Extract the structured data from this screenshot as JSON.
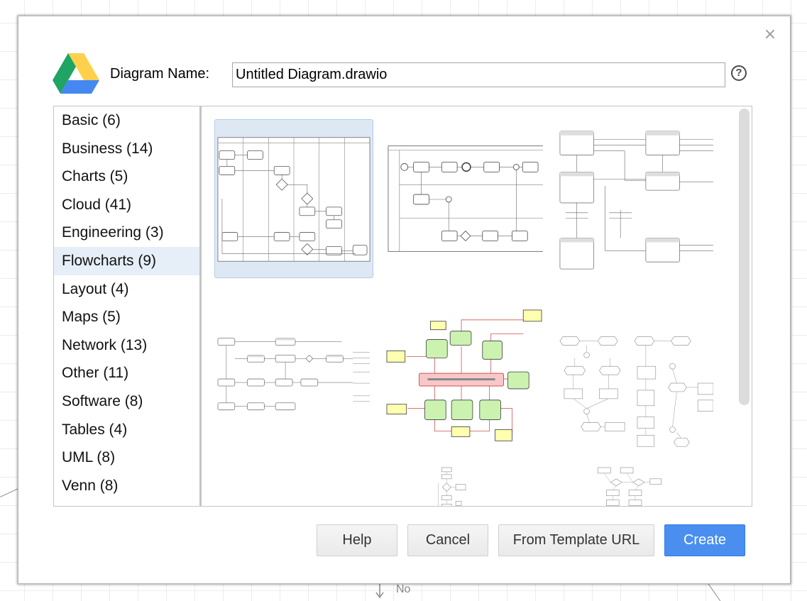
{
  "dialog": {
    "name_label": "Diagram Name:",
    "name_value": "Untitled Diagram.drawio",
    "help_glyph": "?",
    "close_glyph": "×"
  },
  "categories": [
    {
      "label": "Basic (6)",
      "selected": false
    },
    {
      "label": "Business (14)",
      "selected": false
    },
    {
      "label": "Charts (5)",
      "selected": false
    },
    {
      "label": "Cloud (41)",
      "selected": false
    },
    {
      "label": "Engineering (3)",
      "selected": false
    },
    {
      "label": "Flowcharts (9)",
      "selected": true
    },
    {
      "label": "Layout (4)",
      "selected": false
    },
    {
      "label": "Maps (5)",
      "selected": false
    },
    {
      "label": "Network (13)",
      "selected": false
    },
    {
      "label": "Other (11)",
      "selected": false
    },
    {
      "label": "Software (8)",
      "selected": false
    },
    {
      "label": "Tables (4)",
      "selected": false
    },
    {
      "label": "UML (8)",
      "selected": false
    },
    {
      "label": "Venn (8)",
      "selected": false
    }
  ],
  "templates": [
    {
      "name": "cross-functional-flowchart-template",
      "selected": true
    },
    {
      "name": "bpmn-pool-template",
      "selected": false
    },
    {
      "name": "function-block-template",
      "selected": false
    },
    {
      "name": "process-flow-template",
      "selected": false
    },
    {
      "name": "development-process-template",
      "selected": false
    },
    {
      "name": "hexagon-flow-template",
      "selected": false
    },
    {
      "name": "small-flowchart-template",
      "selected": false
    },
    {
      "name": "decision-flow-template",
      "selected": false
    }
  ],
  "buttons": {
    "help": "Help",
    "cancel": "Cancel",
    "template_url": "From Template URL",
    "create": "Create"
  },
  "background": {
    "label": "No"
  },
  "colors": {
    "primary": "#4a8ff0",
    "selected_bg": "#dee8f5",
    "category_selected": "#e6eef7",
    "drive_green": "#1fa463",
    "drive_yellow": "#ffd04b",
    "drive_blue": "#4688f1"
  }
}
